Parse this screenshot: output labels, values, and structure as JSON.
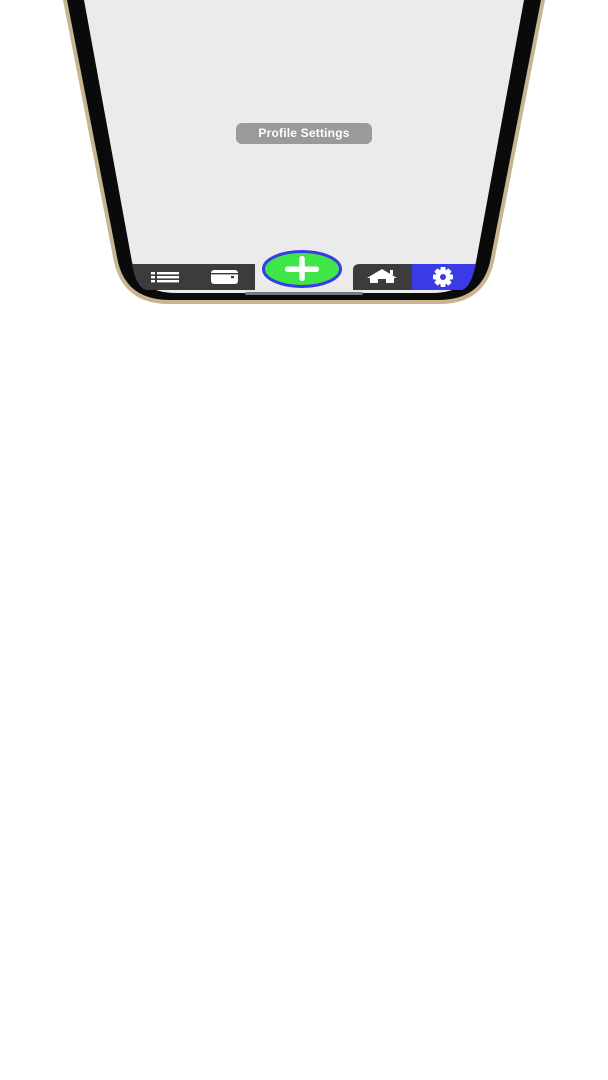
{
  "screen": {
    "label": "Profile Settings"
  },
  "tab_bar": {
    "items": [
      {
        "icon": "list-icon",
        "selected": false
      },
      {
        "icon": "wallet-icon",
        "selected": false
      },
      {
        "icon": "plus-icon",
        "selected": false
      },
      {
        "icon": "home-icon",
        "selected": false
      },
      {
        "icon": "gear-icon",
        "selected": true
      }
    ]
  },
  "colors": {
    "screen_background": "#ebebeb",
    "bezel": "#0a0a0a",
    "frame": "#c8b48e",
    "tab_bar": "#3c3c3c",
    "active_tab": "#3a3ae6",
    "add_button_fill": "#3ee64a",
    "add_button_border": "#3a3ae6",
    "label_pill": "#9a9a9a"
  }
}
